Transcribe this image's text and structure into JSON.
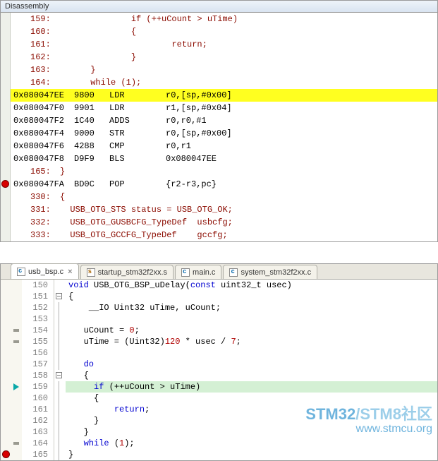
{
  "disassembly": {
    "title": "Disassembly",
    "lines": [
      {
        "t": "src",
        "n": "159:",
        "txt": "              if (++uCount > uTime)",
        "gutter": ""
      },
      {
        "t": "src",
        "n": "160:",
        "txt": "              {",
        "gutter": ""
      },
      {
        "t": "src",
        "n": "161:",
        "txt": "                      return;",
        "gutter": ""
      },
      {
        "t": "src",
        "n": "162:",
        "txt": "              }",
        "gutter": ""
      },
      {
        "t": "src",
        "n": "163:",
        "txt": "      }",
        "gutter": ""
      },
      {
        "t": "src",
        "n": "164:",
        "txt": "      while (1);",
        "gutter": ""
      },
      {
        "t": "asm",
        "hl": true,
        "addr": "0x080047EE",
        "opc": "9800",
        "mne": "LDR",
        "args": "r0,[sp,#0x00]",
        "gutter": ""
      },
      {
        "t": "asm",
        "addr": "0x080047F0",
        "opc": "9901",
        "mne": "LDR",
        "args": "r1,[sp,#0x04]",
        "gutter": ""
      },
      {
        "t": "asm",
        "addr": "0x080047F2",
        "opc": "1C40",
        "mne": "ADDS",
        "args": "r0,r0,#1",
        "gutter": ""
      },
      {
        "t": "asm",
        "addr": "0x080047F4",
        "opc": "9000",
        "mne": "STR",
        "args": "r0,[sp,#0x00]",
        "gutter": ""
      },
      {
        "t": "asm",
        "addr": "0x080047F6",
        "opc": "4288",
        "mne": "CMP",
        "args": "r0,r1",
        "gutter": ""
      },
      {
        "t": "asm",
        "addr": "0x080047F8",
        "opc": "D9F9",
        "mne": "BLS",
        "args": "0x080047EE",
        "gutter": ""
      },
      {
        "t": "src",
        "n": "165:",
        "txt": "}",
        "gutter": ""
      },
      {
        "t": "asm",
        "addr": "0x080047FA",
        "opc": "BD0C",
        "mne": "POP",
        "args": "{r2-r3,pc}",
        "gutter": "bp"
      },
      {
        "t": "src",
        "n": "330:",
        "txt": "{",
        "gutter": ""
      },
      {
        "t": "src",
        "n": "331:",
        "txt": "  USB_OTG_STS status = USB_OTG_OK;",
        "gutter": ""
      },
      {
        "t": "src",
        "n": "332:",
        "txt": "  USB_OTG_GUSBCFG_TypeDef  usbcfg;",
        "gutter": ""
      },
      {
        "t": "src",
        "n": "333:",
        "txt": "  USB_OTG_GCCFG_TypeDef    gccfg;",
        "gutter": ""
      }
    ]
  },
  "tabs": [
    {
      "label": "usb_bsp.c",
      "icon": "c",
      "active": true,
      "closeable": true
    },
    {
      "label": "startup_stm32f2xx.s",
      "icon": "s",
      "active": false,
      "closeable": false
    },
    {
      "label": "main.c",
      "icon": "c",
      "active": false,
      "closeable": false
    },
    {
      "label": "system_stm32f2xx.c",
      "icon": "c",
      "active": false,
      "closeable": false
    }
  ],
  "source": {
    "lines": [
      {
        "n": 150,
        "mark": "",
        "bp": "",
        "fold": "",
        "html": "<span class='kw'>void</span> USB_OTG_BSP_uDelay(<span class='kw'>const</span> uint32_t usec)"
      },
      {
        "n": 151,
        "mark": "",
        "bp": "",
        "fold": "box",
        "html": "{"
      },
      {
        "n": 152,
        "mark": "",
        "bp": "",
        "fold": "line",
        "html": "    __IO Uint32 uTime, uCount;"
      },
      {
        "n": 153,
        "mark": "",
        "bp": "",
        "fold": "line",
        "html": ""
      },
      {
        "n": 154,
        "mark": "dash",
        "bp": "",
        "fold": "line",
        "html": "   uCount = <span class='num'>0</span>;"
      },
      {
        "n": 155,
        "mark": "dash",
        "bp": "",
        "fold": "line",
        "html": "   uTime = (Uint32)<span class='num'>120</span> * usec / <span class='num'>7</span>;"
      },
      {
        "n": 156,
        "mark": "",
        "bp": "",
        "fold": "line",
        "html": ""
      },
      {
        "n": 157,
        "mark": "",
        "bp": "",
        "fold": "line",
        "html": "   <span class='kw'>do</span>"
      },
      {
        "n": 158,
        "mark": "",
        "bp": "",
        "fold": "box",
        "html": "   {"
      },
      {
        "n": 159,
        "mark": "cursor",
        "bp": "",
        "fold": "line",
        "hl": true,
        "html": "     <span class='kw'>if</span> (++uCount > uTime)"
      },
      {
        "n": 160,
        "mark": "",
        "bp": "",
        "fold": "line",
        "html": "     {"
      },
      {
        "n": 161,
        "mark": "",
        "bp": "",
        "fold": "line",
        "html": "         <span class='kw'>return</span>;"
      },
      {
        "n": 162,
        "mark": "",
        "bp": "",
        "fold": "line",
        "html": "     }"
      },
      {
        "n": 163,
        "mark": "",
        "bp": "",
        "fold": "line",
        "html": "   }"
      },
      {
        "n": 164,
        "mark": "dash",
        "bp": "",
        "fold": "line",
        "html": "   <span class='kw'>while</span> (<span class='num'>1</span>);"
      },
      {
        "n": 165,
        "mark": "",
        "bp": "bp",
        "fold": "line",
        "html": "}"
      }
    ]
  },
  "watermark": {
    "line1_a": "STM32",
    "line1_b": "/STM8社区",
    "line2": "www.stmcu.org"
  }
}
